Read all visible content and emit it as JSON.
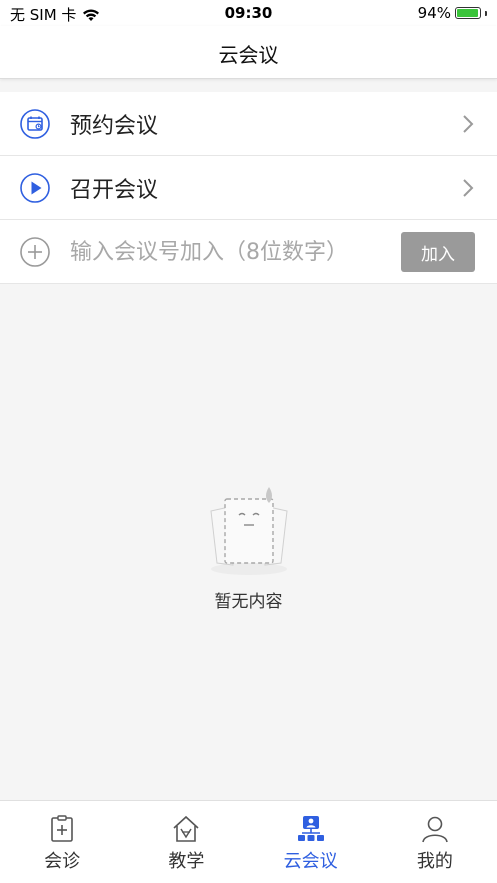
{
  "status_bar": {
    "carrier": "无 SIM 卡",
    "time": "09:30",
    "battery_percent": "94%",
    "battery_level": 0.94
  },
  "header": {
    "title": "云会议"
  },
  "menu": {
    "schedule_label": "预约会议",
    "start_label": "召开会议",
    "join_placeholder": "输入会议号加入（8位数字）",
    "join_button": "加入"
  },
  "empty_state": {
    "text": "暂无内容"
  },
  "tabs": [
    {
      "label": "会诊",
      "icon": "medical-clipboard-icon",
      "active": false
    },
    {
      "label": "教学",
      "icon": "teaching-house-icon",
      "active": false
    },
    {
      "label": "云会议",
      "icon": "cloud-meeting-icon",
      "active": true
    },
    {
      "label": "我的",
      "icon": "profile-icon",
      "active": false
    }
  ],
  "colors": {
    "accent": "#2f5fe0",
    "join_button_bg": "#9a9a9a",
    "background": "#f5f5f5"
  }
}
